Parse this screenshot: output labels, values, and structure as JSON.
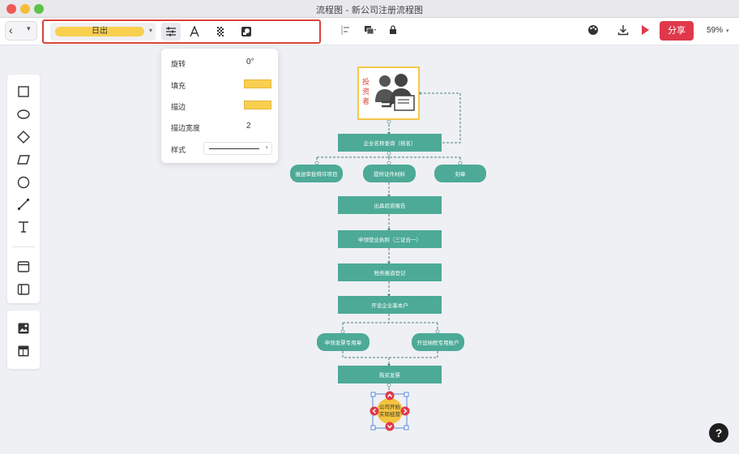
{
  "window": {
    "title": "流程图 - 新公司注册流程图"
  },
  "toolbar": {
    "style_value": "日出",
    "zoom_level": "59%",
    "share_label": "分享"
  },
  "properties": {
    "rotation_label": "旋转",
    "rotation_value": "0°",
    "fill_label": "填充",
    "fill_color": "#f9cf4f",
    "stroke_label": "描边",
    "stroke_color": "#f9cf4f",
    "stroke_width_label": "描边宽度",
    "stroke_width_value": "2",
    "style_label": "样式"
  },
  "left_tools": [
    "rectangle-tool",
    "ellipse-tool",
    "diamond-tool",
    "parallelogram-tool",
    "circle-tool",
    "line-tool",
    "text-tool",
    "container-tool",
    "swimlane-tool",
    "image-tool",
    "template-tool"
  ],
  "flowchart": {
    "investor_label": "投资者",
    "name_query": "企业名称查询（核名）",
    "branch_1": "报送审批特许项目",
    "branch_2": "提供证件材料",
    "branch_3": "刻章",
    "capital_report": "出具验资报告",
    "business_license": "申领营业执照（三证合一）",
    "tax_registration": "税务报道登记",
    "bank_account": "开设企业基本户",
    "invoice_seal": "申领发票专用章",
    "tax_account": "开设纳税专用账户",
    "buy_invoice": "购买发票",
    "end_node": "公司开始实际经营"
  },
  "colors": {
    "node": "#4daa97",
    "accent": "#e0384a",
    "highlight": "#d9443a",
    "yellow": "#f9cf4f"
  }
}
